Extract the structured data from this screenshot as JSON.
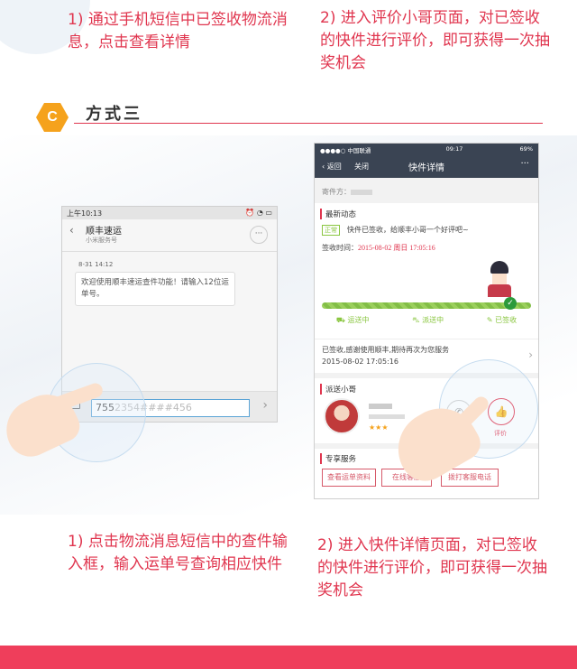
{
  "top": {
    "step1_text": "1) 通过手机短信中已签收物流消息，点击查看详情",
    "step2_text": "2) 进入评价小哥页面，对已签收的快件进行评价，即可获得一次抽奖机会"
  },
  "section": {
    "badge": "C",
    "title": "方式三"
  },
  "sms_phone": {
    "status_time": "上午10:13",
    "contact_name": "顺丰速运",
    "contact_sub": "小米服务号",
    "message_time": "8-31 14:12",
    "message_text": "欢迎使用顺丰速运查件功能！请输入12位运单号。",
    "input_value": "755",
    "input_value_blurred": "2354####456",
    "send_icon": "chevron-right-icon"
  },
  "app_phone": {
    "carrier": "●●●●○ 中国联通",
    "time": "09:17",
    "battery": "69%",
    "back_label": "返回",
    "close_label": "关闭",
    "title": "快件详情",
    "sender_label": "寄件方：",
    "latest_title": "最新动态",
    "latest_tag": "正常",
    "latest_text": "快件已签收，给顺丰小哥一个好评吧~",
    "sign_label": "签收时间：",
    "sign_time": "2015-08-02 周日 17:05:16",
    "stages": [
      "运送中",
      "派送中",
      "已签收"
    ],
    "status_text": "已签收,感谢使用顺丰,期待再次为您服务",
    "status_time": "2015-08-02 17:05:16",
    "courier_title": "派送小哥",
    "rate_label": "评价",
    "service_title": "专享服务",
    "services": [
      "查看运单资料",
      "在线客服",
      "拨打客服电话"
    ]
  },
  "bottom": {
    "step1_text": "1) 点击物流消息短信中的查件输入框，输入运单号查询相应快件",
    "step2_text": "2) 进入快件详情页面，对已签收的快件进行评价，即可获得一次抽奖机会"
  },
  "colors": {
    "accent_red": "#e0364f",
    "badge_orange": "#f5a21c",
    "footer_pink": "#ef3e5b",
    "app_green": "#8ac640",
    "app_dark": "#3a4453"
  }
}
